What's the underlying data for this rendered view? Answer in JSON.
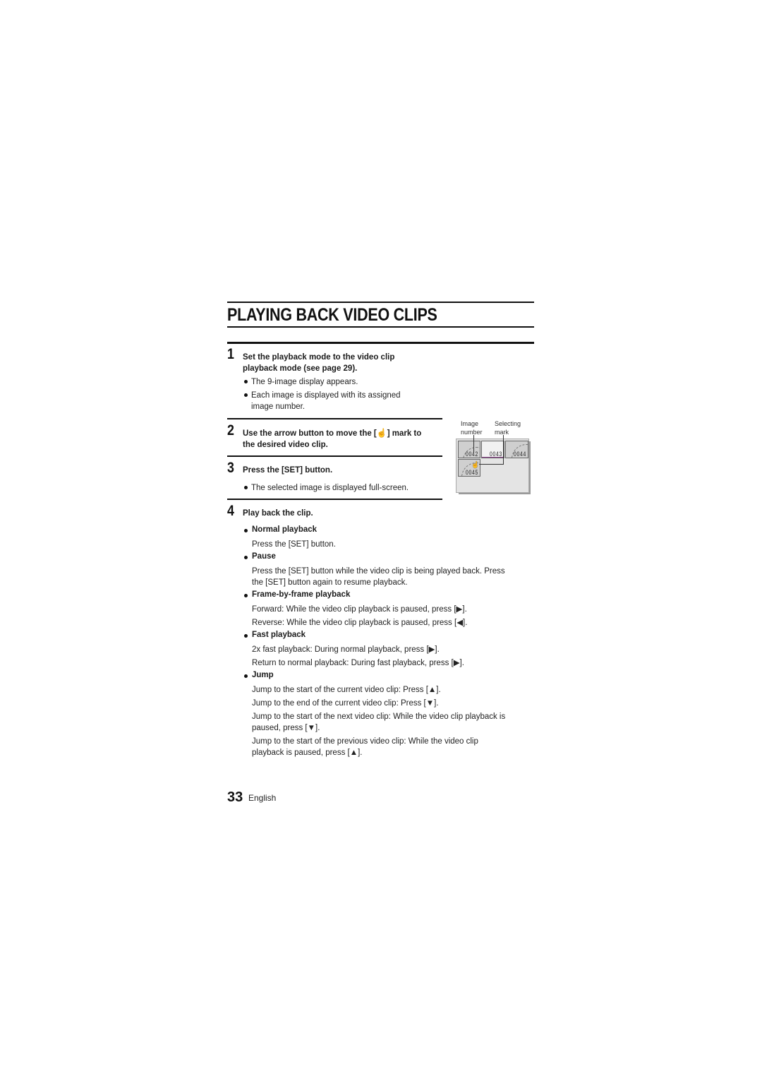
{
  "page": {
    "title": "PLAYING BACK VIDEO CLIPS",
    "page_number": "33",
    "language": "English"
  },
  "steps": [
    {
      "number": "1",
      "heading": [
        "Set the playback mode to the video clip",
        "playback mode (see page 29)."
      ],
      "bullets": [
        [
          "The 9-image display appears."
        ],
        [
          "Each image is displayed with its assigned",
          "image number."
        ]
      ]
    },
    {
      "number": "2",
      "heading_pre": "Use the arrow button to move the [",
      "heading_icon": "hand-pointer-icon",
      "heading_post": "] mark to",
      "heading_line2": "the desired video clip."
    },
    {
      "number": "3",
      "heading": [
        "Press the [SET] button."
      ],
      "bullets": [
        [
          "The selected image is displayed full-screen."
        ]
      ]
    },
    {
      "number": "4",
      "heading": [
        "Play back the clip."
      ],
      "sections": [
        {
          "title": "Normal playback",
          "lines": [
            "Press the [SET] button."
          ]
        },
        {
          "title": "Pause",
          "lines": [
            "Press the [SET] button while the video clip is being played back. Press",
            "the [SET] button again to resume playback."
          ]
        },
        {
          "title": "Frame-by-frame playback",
          "lines": [
            "Forward: While the video clip playback is paused, press [▶].",
            "Reverse: While the video clip playback is paused, press [◀]."
          ]
        },
        {
          "title": "Fast playback",
          "lines": [
            "2x fast playback: During normal playback, press [▶].",
            "Return to normal playback: During fast playback, press [▶]."
          ]
        },
        {
          "title": "Jump",
          "lines": [
            "Jump to the start of the current video clip: Press [▲].",
            "Jump to the end of the current video clip: Press [▼].",
            "Jump to the start of the next video clip: While the video clip playback is",
            "paused, press [▼].",
            "Jump to the start of the previous video clip: While the video clip",
            "playback is paused, press [▲]."
          ]
        }
      ]
    }
  ],
  "figure": {
    "callouts": {
      "image_number": [
        "Image",
        "number"
      ],
      "selecting_mark": [
        "Selecting",
        "mark"
      ]
    },
    "thumbnails": [
      "0042",
      "0043",
      "0044",
      "0045"
    ]
  }
}
